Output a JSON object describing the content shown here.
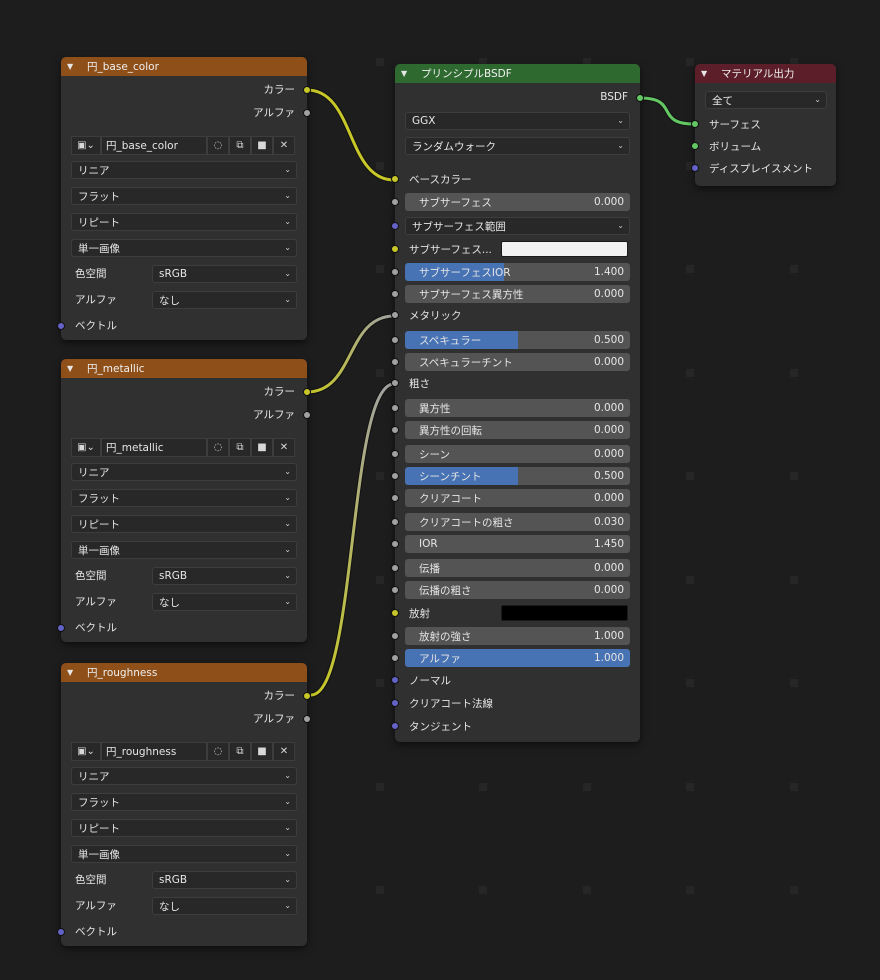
{
  "texture_nodes": [
    {
      "title": "円_base_color",
      "outputs": {
        "color": "カラー",
        "alpha": "アルファ"
      },
      "image_name": "円_base_color",
      "interpolation": "リニア",
      "projection": "フラット",
      "extension": "リピート",
      "source": "単一画像",
      "colorspace_label": "色空間",
      "colorspace_value": "sRGB",
      "alpha_label": "アルファ",
      "alpha_value": "なし",
      "vector": "ベクトル"
    },
    {
      "title": "円_metallic",
      "outputs": {
        "color": "カラー",
        "alpha": "アルファ"
      },
      "image_name": "円_metallic",
      "interpolation": "リニア",
      "projection": "フラット",
      "extension": "リピート",
      "source": "単一画像",
      "colorspace_label": "色空間",
      "colorspace_value": "sRGB",
      "alpha_label": "アルファ",
      "alpha_value": "なし",
      "vector": "ベクトル"
    },
    {
      "title": "円_roughness",
      "outputs": {
        "color": "カラー",
        "alpha": "アルファ"
      },
      "image_name": "円_roughness",
      "interpolation": "リニア",
      "projection": "フラット",
      "extension": "リピート",
      "source": "単一画像",
      "colorspace_label": "色空間",
      "colorspace_value": "sRGB",
      "alpha_label": "アルファ",
      "alpha_value": "なし",
      "vector": "ベクトル"
    }
  ],
  "bsdf_node": {
    "title": "プリンシプルBSDF",
    "output": "BSDF",
    "distribution": "GGX",
    "subsurface_method": "ランダムウォーク",
    "base_color": "ベースカラー",
    "subsurface": {
      "label": "サブサーフェス",
      "value": "0.000"
    },
    "subsurface_radius": "サブサーフェス範囲",
    "subsurface_color": "サブサーフェス...",
    "subsurface_ior": {
      "label": "サブサーフェスIOR",
      "value": "1.400",
      "fill": 0.44
    },
    "subsurface_anisotropy": {
      "label": "サブサーフェス異方性",
      "value": "0.000"
    },
    "metallic": "メタリック",
    "specular": {
      "label": "スペキュラー",
      "value": "0.500",
      "fill": 0.5
    },
    "specular_tint": {
      "label": "スペキュラーチント",
      "value": "0.000"
    },
    "roughness": "粗さ",
    "anisotropic": {
      "label": "異方性",
      "value": "0.000"
    },
    "anisotropic_rotation": {
      "label": "異方性の回転",
      "value": "0.000"
    },
    "sheen": {
      "label": "シーン",
      "value": "0.000"
    },
    "sheen_tint": {
      "label": "シーンチント",
      "value": "0.500",
      "fill": 0.5
    },
    "clearcoat": {
      "label": "クリアコート",
      "value": "0.000"
    },
    "clearcoat_roughness": {
      "label": "クリアコートの粗さ",
      "value": "0.030"
    },
    "ior": {
      "label": "IOR",
      "value": "1.450"
    },
    "transmission": {
      "label": "伝播",
      "value": "0.000"
    },
    "transmission_roughness": {
      "label": "伝播の粗さ",
      "value": "0.000"
    },
    "emission": "放射",
    "emission_strength": {
      "label": "放射の強さ",
      "value": "1.000"
    },
    "alpha": {
      "label": "アルファ",
      "value": "1.000",
      "fill": 1.0
    },
    "normal": "ノーマル",
    "clearcoat_normal": "クリアコート法線",
    "tangent": "タンジェント",
    "colors": {
      "subsurface_color": "#f2f2f2",
      "emission_color": "#000000"
    }
  },
  "output_node": {
    "title": "マテリアル出力",
    "target": "全て",
    "surface": "サーフェス",
    "volume": "ボリューム",
    "displacement": "ディスプレイスメント"
  },
  "theme": {
    "background": "#1d1d1d",
    "node_body": "#303030",
    "texture_header": "#8e4f18",
    "bsdf_header": "#2e6930",
    "output_header": "#5c1f29",
    "wire_yellow": "#c7c729",
    "wire_grey": "#a1a1a1",
    "wire_green": "#63c763",
    "slider_fill": "#4772b3"
  }
}
